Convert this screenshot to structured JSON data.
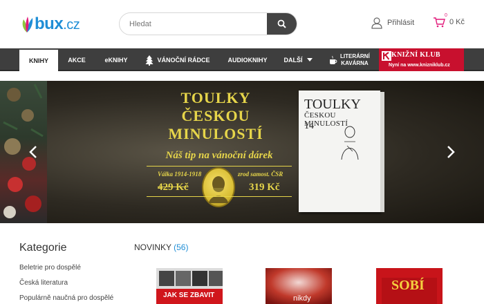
{
  "header": {
    "logo_text": "bux",
    "logo_tld": ".cz",
    "search_placeholder": "Hledat",
    "login_label": "Přihlásit",
    "cart_count": "0",
    "cart_total": "0 Kč"
  },
  "nav": {
    "items": [
      {
        "label": "KNIHY"
      },
      {
        "label": "AKCE"
      },
      {
        "label": "eKNIHY"
      },
      {
        "label": "VÁNOČNÍ RÁDCE"
      },
      {
        "label": "AUDIOKNIHY"
      },
      {
        "label": "DALŠÍ"
      },
      {
        "label": "LITERÁRNÍ KAVÁRNA"
      }
    ],
    "club_title": "KNIŽNÍ KLUB",
    "club_subtitle": "Nyní na www.knizniklub.cz"
  },
  "banner": {
    "title_lines": [
      "TOULKY",
      "ČESKOU",
      "MINULOSTÍ"
    ],
    "tip": "Náš tip na vánoční dárek",
    "left_caption": "Válka 1914-1918",
    "right_caption": "zrod samost. ČSR",
    "old_price": "429 Kč",
    "new_price": "319 Kč",
    "book_title": "TOULKY",
    "book_subtitle": "ČESKOU MINULOSTÍ",
    "book_number": "14"
  },
  "sidebar": {
    "title": "Kategorie",
    "categories": [
      "Beletrie pro dospělé",
      "Česká literatura",
      "Populárně naučná pro dospělé"
    ]
  },
  "news": {
    "title": "NOVINKY",
    "count": "(56)",
    "products": [
      {
        "cover_text": "JAK SE ZBAVIT"
      },
      {
        "cover_text": "nikdy"
      },
      {
        "cover_text": "SOBÍ"
      }
    ]
  },
  "colors": {
    "brand_blue": "#1f8ed6",
    "nav_bg": "#3e3e3e",
    "club_red": "#c8102e",
    "banner_gold": "#e6d54a"
  }
}
